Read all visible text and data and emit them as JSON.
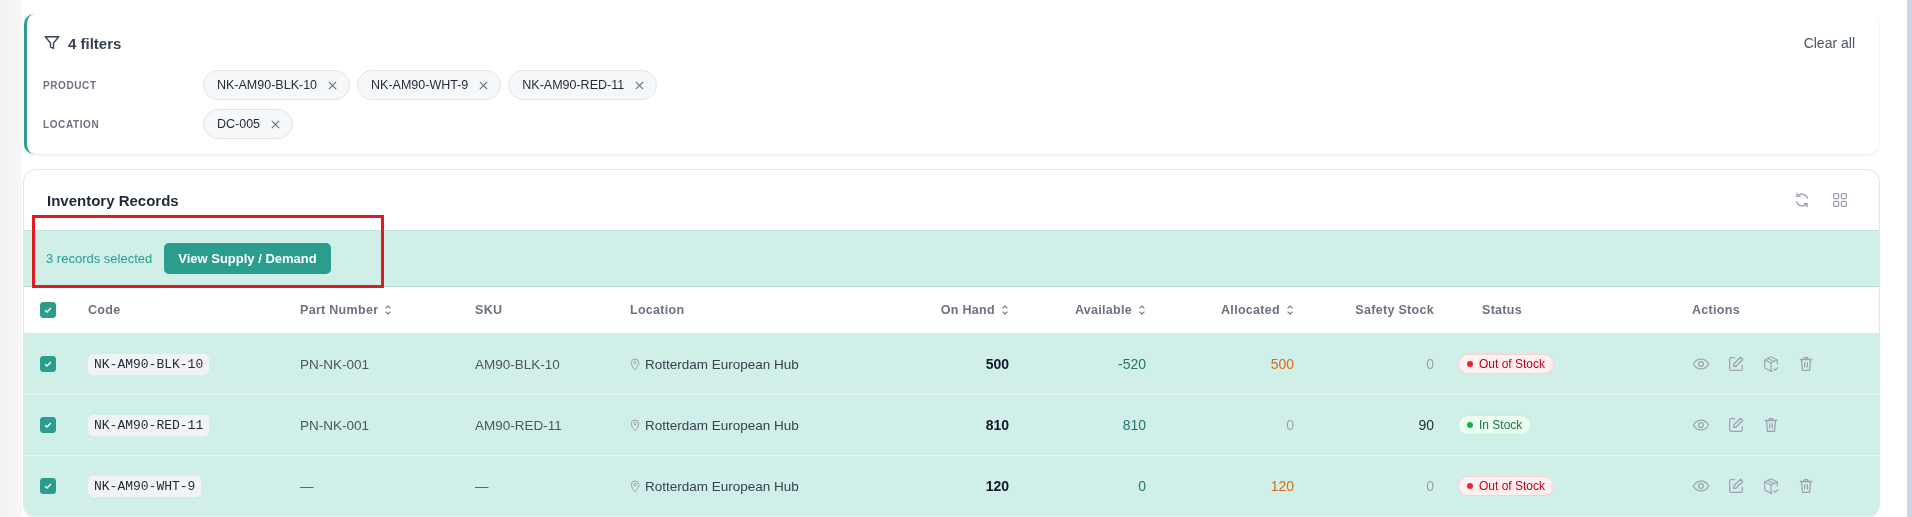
{
  "filters": {
    "title": "4 filters",
    "clear_label": "Clear all",
    "groups": [
      {
        "label": "PRODUCT",
        "chips": [
          "NK-AM90-BLK-10",
          "NK-AM90-WHT-9",
          "NK-AM90-RED-11"
        ]
      },
      {
        "label": "LOCATION",
        "chips": [
          "DC-005"
        ]
      }
    ]
  },
  "records": {
    "title": "Inventory Records",
    "selection_text": "3 records selected",
    "selection_button": "View Supply / Demand",
    "all_checked": true,
    "columns": [
      {
        "label": "Code",
        "sortable": false
      },
      {
        "label": "Part Number",
        "sortable": true
      },
      {
        "label": "SKU",
        "sortable": false
      },
      {
        "label": "Location",
        "sortable": false
      },
      {
        "label": "On Hand",
        "sortable": true
      },
      {
        "label": "Available",
        "sortable": true
      },
      {
        "label": "Allocated",
        "sortable": true
      },
      {
        "label": "Safety Stock",
        "sortable": false
      },
      {
        "label": "Status",
        "sortable": false
      },
      {
        "label": "Actions",
        "sortable": false
      }
    ],
    "rows": [
      {
        "selected": true,
        "code": "NK-AM90-BLK-10",
        "part_number": "PN-NK-001",
        "sku": "AM90-BLK-10",
        "location": "Rotterdam European Hub",
        "on_hand": "500",
        "available": "-520",
        "allocated": {
          "text": "500",
          "muted": false
        },
        "safety_stock": {
          "text": "0",
          "muted": true
        },
        "status": {
          "label": "Out of Stock",
          "kind": "out"
        },
        "actions": [
          {
            "kind": "view"
          },
          {
            "kind": "edit"
          },
          {
            "kind": "package"
          },
          {
            "kind": "delete"
          }
        ]
      },
      {
        "selected": true,
        "code": "NK-AM90-RED-11",
        "part_number": "PN-NK-001",
        "sku": "AM90-RED-11",
        "location": "Rotterdam European Hub",
        "on_hand": "810",
        "available": "810",
        "allocated": {
          "text": "0",
          "muted": true
        },
        "safety_stock": {
          "text": "90",
          "muted": false
        },
        "status": {
          "label": "In Stock",
          "kind": "in"
        },
        "actions": [
          {
            "kind": "view"
          },
          {
            "kind": "edit"
          },
          {
            "kind": "delete"
          }
        ]
      },
      {
        "selected": true,
        "code": "NK-AM90-WHT-9",
        "part_number": "—",
        "sku": "—",
        "location": "Rotterdam European Hub",
        "on_hand": "120",
        "available": "0",
        "allocated": {
          "text": "120",
          "muted": false
        },
        "safety_stock": {
          "text": "0",
          "muted": true
        },
        "status": {
          "label": "Out of Stock",
          "kind": "out"
        },
        "actions": [
          {
            "kind": "view"
          },
          {
            "kind": "edit"
          },
          {
            "kind": "package"
          },
          {
            "kind": "delete"
          }
        ]
      }
    ]
  }
}
